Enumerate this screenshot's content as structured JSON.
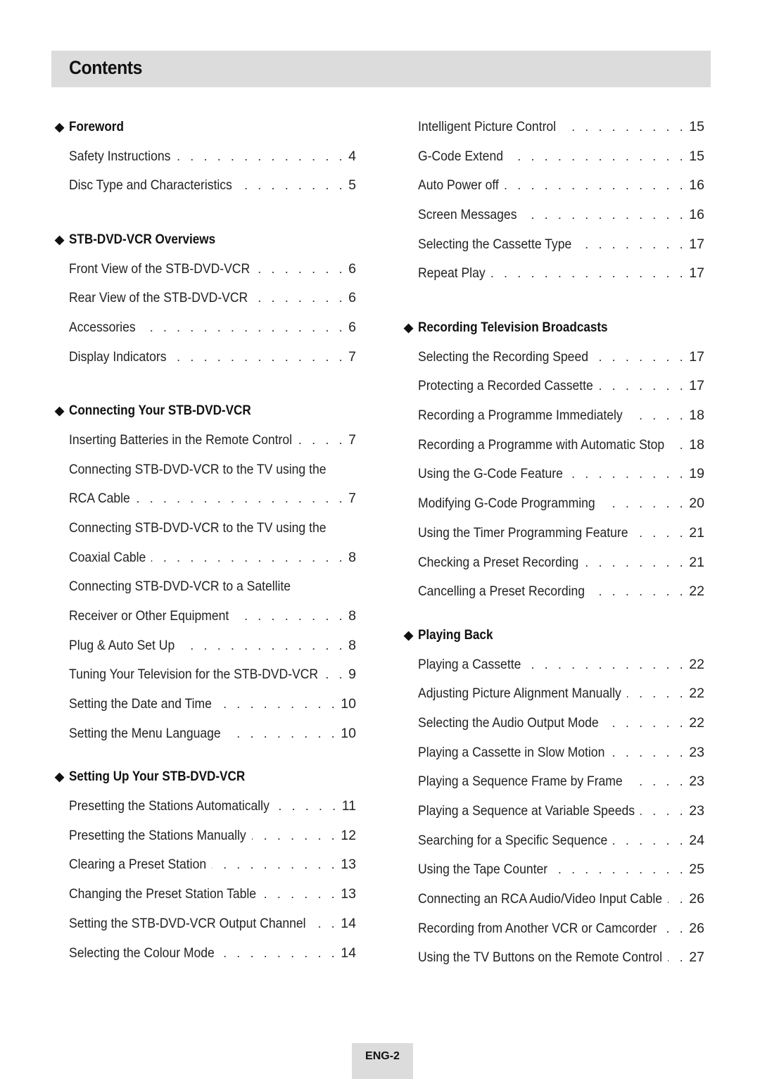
{
  "header": {
    "title": "Contents"
  },
  "bullet_glyph": "◆",
  "columns": [
    {
      "sections": [
        {
          "heading": "Foreword",
          "items": [
            {
              "title": "Safety Instructions",
              "page": "4"
            },
            {
              "title": "Disc Type and Characteristics",
              "page": "5"
            }
          ]
        },
        {
          "heading": "STB-DVD-VCR Overviews",
          "items": [
            {
              "title": "Front View of the STB-DVD-VCR",
              "page": "6"
            },
            {
              "title": "Rear View of the STB-DVD-VCR",
              "page": "6"
            },
            {
              "title": "Accessories",
              "page": "6"
            },
            {
              "title": "Display Indicators",
              "page": "7"
            }
          ]
        },
        {
          "heading": "Connecting Your STB-DVD-VCR",
          "items": [
            {
              "title": "Inserting Batteries in the Remote Control",
              "page": "7"
            },
            {
              "title": "Connecting STB-DVD-VCR to the TV using the",
              "page": ""
            },
            {
              "title": "RCA Cable",
              "page": "7"
            },
            {
              "title": "Connecting STB-DVD-VCR to the TV using the",
              "page": ""
            },
            {
              "title": "Coaxial Cable",
              "page": "8"
            },
            {
              "title": "Connecting STB-DVD-VCR to a Satellite",
              "page": ""
            },
            {
              "title": "Receiver or Other Equipment",
              "page": "8"
            },
            {
              "title": "Plug & Auto Set Up",
              "page": "8"
            },
            {
              "title": "Tuning Your Television for the STB-DVD-VCR",
              "page": "9"
            },
            {
              "title": "Setting the Date and Time",
              "page": "10"
            },
            {
              "title": "Setting the Menu Language",
              "page": "10"
            }
          ]
        },
        {
          "heading": "Setting Up Your STB-DVD-VCR",
          "items": [
            {
              "title": "Presetting the Stations Automatically",
              "page": "11"
            },
            {
              "title": "Presetting the Stations Manually",
              "page": "12"
            },
            {
              "title": "Clearing a Preset Station",
              "page": "13"
            },
            {
              "title": "Changing the Preset Station Table",
              "page": "13"
            },
            {
              "title": "Setting the STB-DVD-VCR Output Channel",
              "page": "14"
            },
            {
              "title": "Selecting the Colour Mode",
              "page": "14"
            }
          ]
        }
      ]
    },
    {
      "sections": [
        {
          "heading": "",
          "items": [
            {
              "title": "Intelligent Picture Control",
              "page": "15"
            },
            {
              "title": "G-Code Extend",
              "page": "15"
            },
            {
              "title": "Auto Power off",
              "page": "16"
            },
            {
              "title": "Screen Messages",
              "page": "16"
            },
            {
              "title": "Selecting the Cassette Type",
              "page": "17"
            },
            {
              "title": "Repeat Play",
              "page": "17"
            }
          ]
        },
        {
          "heading": "Recording Television Broadcasts",
          "items": [
            {
              "title": "Selecting the Recording Speed",
              "page": "17"
            },
            {
              "title": "Protecting a Recorded Cassette",
              "page": "17"
            },
            {
              "title": "Recording a Programme Immediately",
              "page": "18"
            },
            {
              "title": "Recording a Programme with Automatic Stop",
              "page": "18"
            },
            {
              "title": "Using the G-Code Feature",
              "page": "19"
            },
            {
              "title": "Modifying G-Code Programming",
              "page": "20"
            },
            {
              "title": "Using the Timer Programming Feature",
              "page": "21"
            },
            {
              "title": "Checking a Preset Recording",
              "page": "21"
            },
            {
              "title": "Cancelling a Preset Recording",
              "page": "22"
            }
          ]
        },
        {
          "heading": "Playing Back",
          "items": [
            {
              "title": "Playing a Cassette",
              "page": "22"
            },
            {
              "title": "Adjusting Picture Alignment Manually",
              "page": "22"
            },
            {
              "title": "Selecting the Audio Output Mode",
              "page": "22"
            },
            {
              "title": "Playing a Cassette in Slow Motion",
              "page": "23"
            },
            {
              "title": "Playing a Sequence Frame by Frame",
              "page": "23"
            },
            {
              "title": "Playing a Sequence at Variable Speeds",
              "page": "23"
            },
            {
              "title": "Searching for a Specific Sequence",
              "page": "24"
            },
            {
              "title": "Using the Tape Counter",
              "page": "25"
            },
            {
              "title": "Connecting an RCA Audio/Video Input Cable",
              "page": "26"
            },
            {
              "title": "Recording from Another VCR or Camcorder",
              "page": "26"
            },
            {
              "title": "Using the TV Buttons on the Remote Control",
              "page": "27"
            }
          ]
        }
      ]
    }
  ],
  "footer": {
    "page_label": "ENG-2"
  }
}
